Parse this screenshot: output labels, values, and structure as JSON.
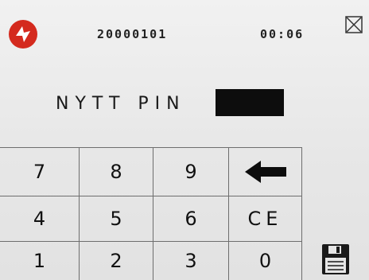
{
  "header": {
    "logo_icon": "brand-logo-icon",
    "date": "20000101",
    "time": "00:06",
    "close_icon": "close-icon"
  },
  "pin": {
    "label": "NYTT PIN",
    "entry_color": "#0d0d0d"
  },
  "keypad": {
    "row1": [
      "7",
      "8",
      "9"
    ],
    "row2": [
      "4",
      "5",
      "6"
    ],
    "row3": [
      "1",
      "2",
      "3"
    ],
    "backspace_icon": "backspace-arrow-icon",
    "clear_label": "CE",
    "zero_label": "0"
  },
  "footer": {
    "save_icon": "save-floppy-icon"
  },
  "colors": {
    "logo_red": "#d42a1e",
    "grid_line": "#6e6e6e"
  }
}
